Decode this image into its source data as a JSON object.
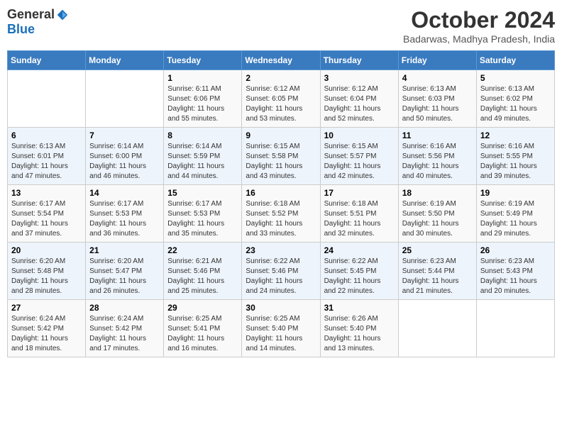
{
  "logo": {
    "general": "General",
    "blue": "Blue"
  },
  "header": {
    "month": "October 2024",
    "location": "Badarwas, Madhya Pradesh, India"
  },
  "weekdays": [
    "Sunday",
    "Monday",
    "Tuesday",
    "Wednesday",
    "Thursday",
    "Friday",
    "Saturday"
  ],
  "weeks": [
    [
      {
        "day": null,
        "content": ""
      },
      {
        "day": null,
        "content": ""
      },
      {
        "day": 1,
        "sunrise": "6:11 AM",
        "sunset": "6:06 PM",
        "daylight": "11 hours and 55 minutes."
      },
      {
        "day": 2,
        "sunrise": "6:12 AM",
        "sunset": "6:05 PM",
        "daylight": "11 hours and 53 minutes."
      },
      {
        "day": 3,
        "sunrise": "6:12 AM",
        "sunset": "6:04 PM",
        "daylight": "11 hours and 52 minutes."
      },
      {
        "day": 4,
        "sunrise": "6:13 AM",
        "sunset": "6:03 PM",
        "daylight": "11 hours and 50 minutes."
      },
      {
        "day": 5,
        "sunrise": "6:13 AM",
        "sunset": "6:02 PM",
        "daylight": "11 hours and 49 minutes."
      }
    ],
    [
      {
        "day": 6,
        "sunrise": "6:13 AM",
        "sunset": "6:01 PM",
        "daylight": "11 hours and 47 minutes."
      },
      {
        "day": 7,
        "sunrise": "6:14 AM",
        "sunset": "6:00 PM",
        "daylight": "11 hours and 46 minutes."
      },
      {
        "day": 8,
        "sunrise": "6:14 AM",
        "sunset": "5:59 PM",
        "daylight": "11 hours and 44 minutes."
      },
      {
        "day": 9,
        "sunrise": "6:15 AM",
        "sunset": "5:58 PM",
        "daylight": "11 hours and 43 minutes."
      },
      {
        "day": 10,
        "sunrise": "6:15 AM",
        "sunset": "5:57 PM",
        "daylight": "11 hours and 42 minutes."
      },
      {
        "day": 11,
        "sunrise": "6:16 AM",
        "sunset": "5:56 PM",
        "daylight": "11 hours and 40 minutes."
      },
      {
        "day": 12,
        "sunrise": "6:16 AM",
        "sunset": "5:55 PM",
        "daylight": "11 hours and 39 minutes."
      }
    ],
    [
      {
        "day": 13,
        "sunrise": "6:17 AM",
        "sunset": "5:54 PM",
        "daylight": "11 hours and 37 minutes."
      },
      {
        "day": 14,
        "sunrise": "6:17 AM",
        "sunset": "5:53 PM",
        "daylight": "11 hours and 36 minutes."
      },
      {
        "day": 15,
        "sunrise": "6:17 AM",
        "sunset": "5:53 PM",
        "daylight": "11 hours and 35 minutes."
      },
      {
        "day": 16,
        "sunrise": "6:18 AM",
        "sunset": "5:52 PM",
        "daylight": "11 hours and 33 minutes."
      },
      {
        "day": 17,
        "sunrise": "6:18 AM",
        "sunset": "5:51 PM",
        "daylight": "11 hours and 32 minutes."
      },
      {
        "day": 18,
        "sunrise": "6:19 AM",
        "sunset": "5:50 PM",
        "daylight": "11 hours and 30 minutes."
      },
      {
        "day": 19,
        "sunrise": "6:19 AM",
        "sunset": "5:49 PM",
        "daylight": "11 hours and 29 minutes."
      }
    ],
    [
      {
        "day": 20,
        "sunrise": "6:20 AM",
        "sunset": "5:48 PM",
        "daylight": "11 hours and 28 minutes."
      },
      {
        "day": 21,
        "sunrise": "6:20 AM",
        "sunset": "5:47 PM",
        "daylight": "11 hours and 26 minutes."
      },
      {
        "day": 22,
        "sunrise": "6:21 AM",
        "sunset": "5:46 PM",
        "daylight": "11 hours and 25 minutes."
      },
      {
        "day": 23,
        "sunrise": "6:22 AM",
        "sunset": "5:46 PM",
        "daylight": "11 hours and 24 minutes."
      },
      {
        "day": 24,
        "sunrise": "6:22 AM",
        "sunset": "5:45 PM",
        "daylight": "11 hours and 22 minutes."
      },
      {
        "day": 25,
        "sunrise": "6:23 AM",
        "sunset": "5:44 PM",
        "daylight": "11 hours and 21 minutes."
      },
      {
        "day": 26,
        "sunrise": "6:23 AM",
        "sunset": "5:43 PM",
        "daylight": "11 hours and 20 minutes."
      }
    ],
    [
      {
        "day": 27,
        "sunrise": "6:24 AM",
        "sunset": "5:42 PM",
        "daylight": "11 hours and 18 minutes."
      },
      {
        "day": 28,
        "sunrise": "6:24 AM",
        "sunset": "5:42 PM",
        "daylight": "11 hours and 17 minutes."
      },
      {
        "day": 29,
        "sunrise": "6:25 AM",
        "sunset": "5:41 PM",
        "daylight": "11 hours and 16 minutes."
      },
      {
        "day": 30,
        "sunrise": "6:25 AM",
        "sunset": "5:40 PM",
        "daylight": "11 hours and 14 minutes."
      },
      {
        "day": 31,
        "sunrise": "6:26 AM",
        "sunset": "5:40 PM",
        "daylight": "11 hours and 13 minutes."
      },
      {
        "day": null,
        "content": ""
      },
      {
        "day": null,
        "content": ""
      }
    ]
  ]
}
